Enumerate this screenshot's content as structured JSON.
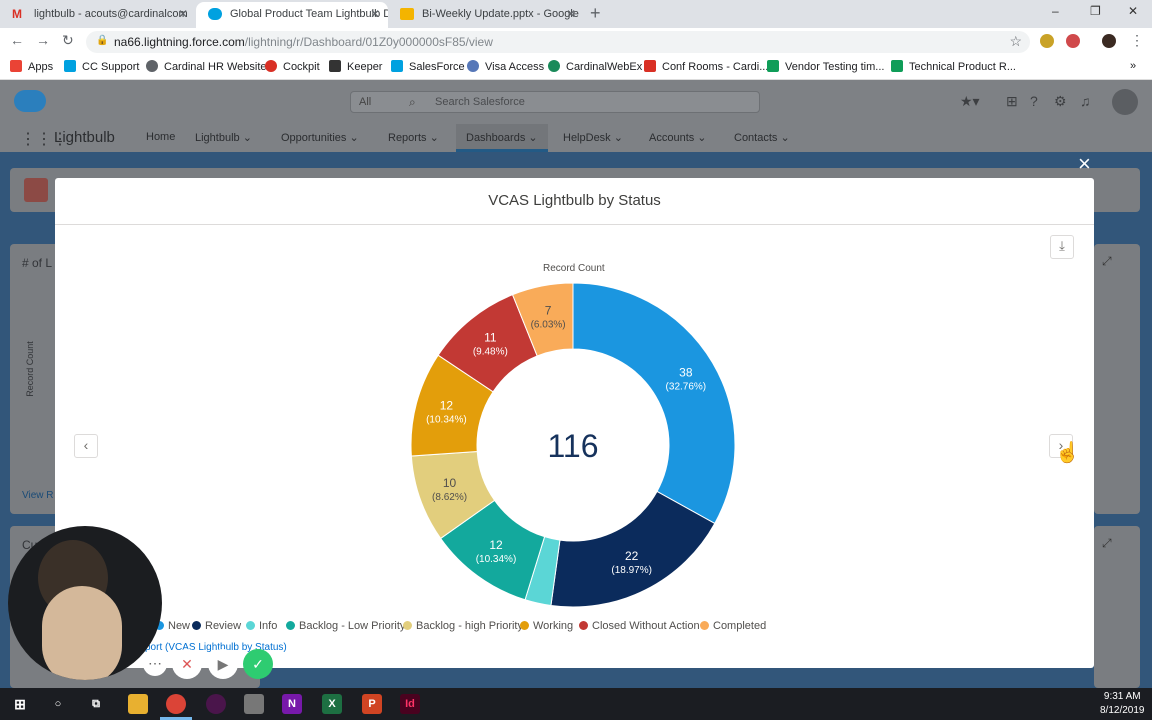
{
  "browser": {
    "tabs": [
      {
        "title": "lightbulb - acouts@cardinalcom",
        "color": "#d93025"
      },
      {
        "title": "Global Product Team Lightbulb D",
        "color": "#00a1e0"
      },
      {
        "title": "Bi-Weekly Update.pptx - Google",
        "color": "#f4b400"
      }
    ],
    "new_tab": "+",
    "url_host": "na66.lightning.force.com",
    "url_path": "/lightning/r/Dashboard/01Z0y000000sF85/view",
    "bookmarks": [
      {
        "label": "Apps",
        "color": "#ea4335"
      },
      {
        "label": "CC Support",
        "color": "#00a1e0"
      },
      {
        "label": "Cardinal HR Website",
        "color": "#5f6368"
      },
      {
        "label": "Cockpit",
        "color": "#d93025"
      },
      {
        "label": "Keeper",
        "color": "#333333"
      },
      {
        "label": "SalesForce",
        "color": "#00a1e0"
      },
      {
        "label": "Visa Access",
        "color": "#5677b8"
      },
      {
        "label": "CardinalWebEx",
        "color": "#1a8a5a"
      },
      {
        "label": "Conf Rooms - Cardi...",
        "color": "#d93025"
      },
      {
        "label": "Vendor Testing tim...",
        "color": "#0f9d58"
      },
      {
        "label": "Technical Product R...",
        "color": "#0f9d58"
      }
    ]
  },
  "salesforce": {
    "search_scope": "All",
    "search_placeholder": "Search Salesforce",
    "app_name": "Lightbulb",
    "nav": [
      "Home",
      "Lightbulb",
      "Opportunities",
      "Reports",
      "Dashboards",
      "HelpDesk",
      "Accounts",
      "Contacts"
    ],
    "selected_nav": "Dashboards"
  },
  "dashboard_bg": {
    "card1_title": "# of L",
    "card1_axis": "Record Count",
    "card1_link": "View R",
    "card2_title": "Cu"
  },
  "modal": {
    "title": "VCAS Lightbulb by Status",
    "close": "×",
    "download_icon": "download-icon",
    "report_link": "port (VCAS Lightbulb by Status)"
  },
  "chart_data": {
    "type": "pie",
    "variant": "donut",
    "title": "Record Count",
    "total": "116",
    "series": [
      {
        "name": "New",
        "value": 38,
        "pct": "32.76%",
        "color": "#1b96e0"
      },
      {
        "name": "Review",
        "value": 22,
        "pct": "18.97%",
        "color": "#0b2b5c"
      },
      {
        "name": "Info",
        "value": 3,
        "pct": "2.59%",
        "color": "#5bd6d6"
      },
      {
        "name": "Backlog - Low Priority",
        "value": 12,
        "pct": "10.34%",
        "color": "#13a99d"
      },
      {
        "name": "Backlog - high Priority",
        "value": 10,
        "pct": "8.62%",
        "color": "#e2ce7d"
      },
      {
        "name": "Working",
        "value": 12,
        "pct": "10.34%",
        "color": "#e39e0b"
      },
      {
        "name": "Closed Without Action",
        "value": 11,
        "pct": "9.48%",
        "color": "#c23934"
      },
      {
        "name": "Completed",
        "value": 7,
        "pct": "6.03%",
        "color": "#f9ab59"
      }
    ],
    "legend_position": "bottom"
  },
  "system": {
    "time": "9:31 AM",
    "date": "8/12/2019"
  }
}
